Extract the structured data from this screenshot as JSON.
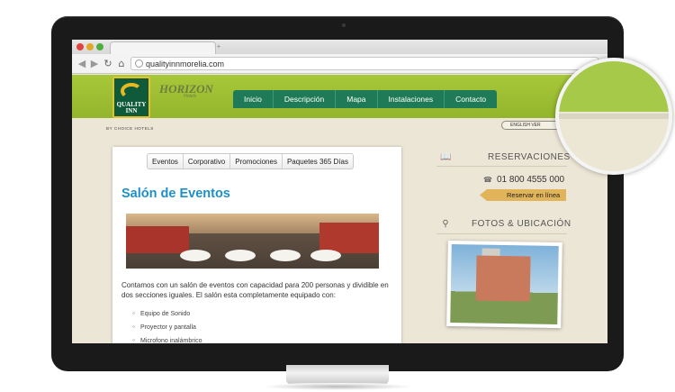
{
  "browser": {
    "url": "qualityinnmorelia.com"
  },
  "site": {
    "logo_text": "QUALITY INN",
    "choice": "BY CHOICE HOTELS",
    "horizon": "HORIZON",
    "horizon_sub": "Hotels",
    "lang": "ENGLISH VER"
  },
  "nav": {
    "items": [
      {
        "label": "Inicio"
      },
      {
        "label": "Descripción"
      },
      {
        "label": "Mapa"
      },
      {
        "label": "Instalaciones"
      },
      {
        "label": "Contacto"
      }
    ]
  },
  "content": {
    "tabs": [
      {
        "label": "Eventos"
      },
      {
        "label": "Corporativo"
      },
      {
        "label": "Promociones"
      },
      {
        "label": "Paquetes 365 Días"
      }
    ],
    "title": "Salón de Eventos",
    "body": "Contamos con un salón de eventos con capacidad para 200 personas y dividible en dos secciones iguales. El salón esta completamente equipado con:",
    "bullets": [
      "Equipo de Sonido",
      "Proyector y pantalla",
      "Microfono inalámbrico"
    ]
  },
  "sidebar": {
    "reservations_title": "RESERVACIONES",
    "phone": "01 800 4555 000",
    "book_label": "Reservar en línea",
    "photos_title": "FOTOS & UBICACIÓN"
  },
  "colors": {
    "header_green": "#9dbd32",
    "nav_green": "#1f7a58",
    "title_blue": "#1e8fc8",
    "book_gold": "#e1b45a"
  }
}
